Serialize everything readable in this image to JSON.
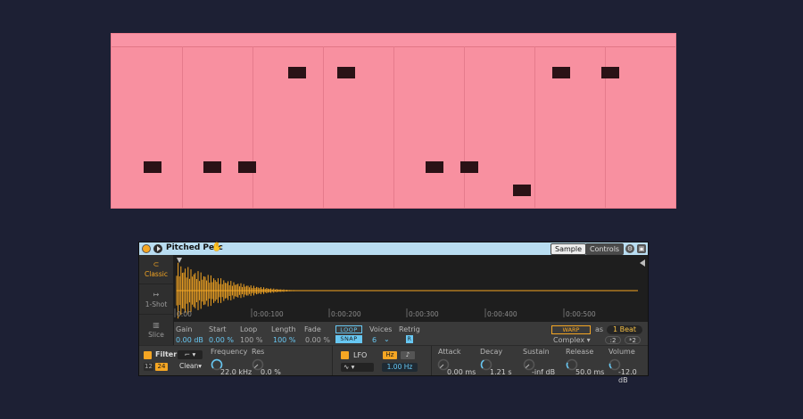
{
  "colors": {
    "background": "#1d2034",
    "clip": "#f890a0",
    "note": "#2a1216",
    "accent_orange": "#f5a623",
    "accent_blue": "#67c7f2",
    "titlebar": "#b9ddf1"
  },
  "piano_roll": {
    "bar_lines": 8,
    "notes": [
      {
        "beat": 0.45,
        "row": 5
      },
      {
        "beat": 1.3,
        "row": 5
      },
      {
        "beat": 1.8,
        "row": 5
      },
      {
        "beat": 2.5,
        "row": 1
      },
      {
        "beat": 3.2,
        "row": 1
      },
      {
        "beat": 4.45,
        "row": 5
      },
      {
        "beat": 4.95,
        "row": 5
      },
      {
        "beat": 5.7,
        "row": 6
      },
      {
        "beat": 6.25,
        "row": 1
      },
      {
        "beat": 6.95,
        "row": 1
      }
    ]
  },
  "device": {
    "name": "Pitched Perc",
    "hand_icon": "hand-icon",
    "tabs": {
      "sample": "Sample",
      "controls": "Controls"
    },
    "modes": [
      {
        "icon": "classic-icon",
        "label": "Classic",
        "active": true
      },
      {
        "icon": "one-shot-icon",
        "label": "1-Shot",
        "active": false
      },
      {
        "icon": "slice-icon",
        "label": "Slice",
        "active": false
      }
    ],
    "time_labels": [
      "0:00",
      "0:00:100",
      "0:00:200",
      "0:00:300",
      "0:00:400",
      "0:00:500"
    ],
    "params": {
      "gain": {
        "label": "Gain",
        "value": "0.00 dB"
      },
      "start": {
        "label": "Start",
        "value": "0.00 %"
      },
      "loop": {
        "label": "Loop",
        "value": "100 %"
      },
      "length": {
        "label": "Length",
        "value": "100 %"
      },
      "fade": {
        "label": "Fade",
        "value": "0.00 %"
      },
      "loop_toggle": "LOOP",
      "snap_toggle": "SNAP",
      "voices": {
        "label": "Voices",
        "value": "6"
      },
      "retrig": {
        "label": "Retrig",
        "value": "R"
      }
    },
    "warp": {
      "label": "WARP",
      "as": "as",
      "beat": "1 Beat",
      "mode": "Complex",
      "half": ":2",
      "double": "*2"
    },
    "filter": {
      "label": "Filter",
      "type_12": "12",
      "type_24": "24",
      "circuit": "Clean",
      "frequency": {
        "label": "Frequency",
        "value": "22.0 kHz"
      },
      "res": {
        "label": "Res",
        "value": "0.0 %"
      }
    },
    "lfo": {
      "label": "LFO",
      "hz": "Hz",
      "sync": "♪",
      "rate": "1.00 Hz"
    },
    "envelope": {
      "attack": {
        "label": "Attack",
        "value": "0.00 ms"
      },
      "decay": {
        "label": "Decay",
        "value": "1.21 s"
      },
      "sustain": {
        "label": "Sustain",
        "value": "-inf dB"
      },
      "release": {
        "label": "Release",
        "value": "50.0 ms"
      },
      "volume": {
        "label": "Volume",
        "value": "-12.0 dB"
      }
    }
  }
}
